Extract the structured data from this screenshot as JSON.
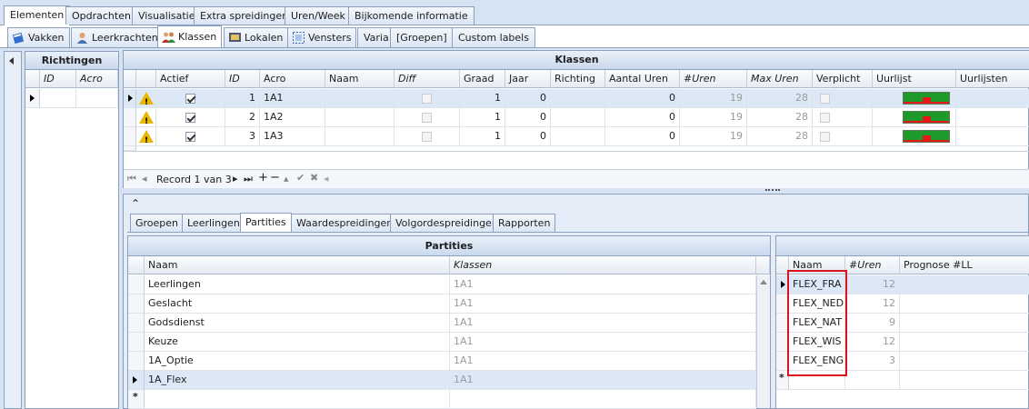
{
  "top_tabs": [
    "Elementen",
    "Opdrachten",
    "Visualisatie",
    "Extra spreidingen",
    "Uren/Week",
    "Bijkomende informatie"
  ],
  "sub_tabs": [
    {
      "label": "Vakken",
      "icon": "book-icon"
    },
    {
      "label": "Leerkrachten",
      "icon": "teacher-icon"
    },
    {
      "label": "Klassen",
      "icon": "class-group-icon"
    },
    {
      "label": "Lokalen",
      "icon": "classroom-icon"
    },
    {
      "label": "Vensters",
      "icon": "window-select-icon"
    },
    {
      "label": "Varia",
      "icon": ""
    },
    {
      "label": "[Groepen]",
      "icon": ""
    },
    {
      "label": "Custom labels",
      "icon": ""
    }
  ],
  "richtingen": {
    "title": "Richtingen",
    "columns": [
      "ID",
      "Acro"
    ]
  },
  "klassen": {
    "title": "Klassen",
    "columns": [
      "Actief",
      "ID",
      "Acro",
      "Naam",
      "Diff",
      "Graad",
      "Jaar",
      "Richting",
      "Aantal Uren",
      "#Uren",
      "Max Uren",
      "Verplicht",
      "Uurlijst",
      "Uurlijsten"
    ],
    "rows": [
      {
        "actief": true,
        "id": "1",
        "acro": "1A1",
        "naam": "",
        "diff": false,
        "graad": "1",
        "jaar": "0",
        "richting": "",
        "aantal_uren": "0",
        "uren": "19",
        "max_uren": "28",
        "verplicht": false
      },
      {
        "actief": true,
        "id": "2",
        "acro": "1A2",
        "naam": "",
        "diff": false,
        "graad": "1",
        "jaar": "0",
        "richting": "",
        "aantal_uren": "0",
        "uren": "19",
        "max_uren": "28",
        "verplicht": false
      },
      {
        "actief": true,
        "id": "3",
        "acro": "1A3",
        "naam": "",
        "diff": false,
        "graad": "1",
        "jaar": "0",
        "richting": "",
        "aantal_uren": "0",
        "uren": "19",
        "max_uren": "28",
        "verplicht": false
      }
    ],
    "navigator": "Record 1 van 3"
  },
  "detail_tabs": [
    "Groepen",
    "Leerlingen",
    "Partities",
    "Waardespreidingen",
    "Volgordespreidingen",
    "Rapporten"
  ],
  "partities": {
    "title": "Partities",
    "columns": [
      "Naam",
      "Klassen"
    ],
    "rows": [
      {
        "naam": "Leerlingen",
        "klassen": "1A1"
      },
      {
        "naam": "Geslacht",
        "klassen": "1A1"
      },
      {
        "naam": "Godsdienst",
        "klassen": "1A1"
      },
      {
        "naam": "Keuze",
        "klassen": "1A1"
      },
      {
        "naam": "1A_Optie",
        "klassen": "1A1"
      },
      {
        "naam": "1A_Flex",
        "klassen": "1A1"
      }
    ],
    "new_row_marker": "*"
  },
  "flex": {
    "columns": [
      "Naam",
      "#Uren",
      "Prognose #LL"
    ],
    "rows": [
      {
        "naam": "FLEX_FRA",
        "uren": "12"
      },
      {
        "naam": "FLEX_NED",
        "uren": "12"
      },
      {
        "naam": "FLEX_NAT",
        "uren": "9"
      },
      {
        "naam": "FLEX_WIS",
        "uren": "12"
      },
      {
        "naam": "FLEX_ENG",
        "uren": "3"
      }
    ],
    "new_row_marker": "*",
    "highlight_color": "#d9141b"
  },
  "colors": {
    "accent": "#8ba0bc",
    "header": "#c9d9ee",
    "selected_row": "#dde8f6"
  }
}
